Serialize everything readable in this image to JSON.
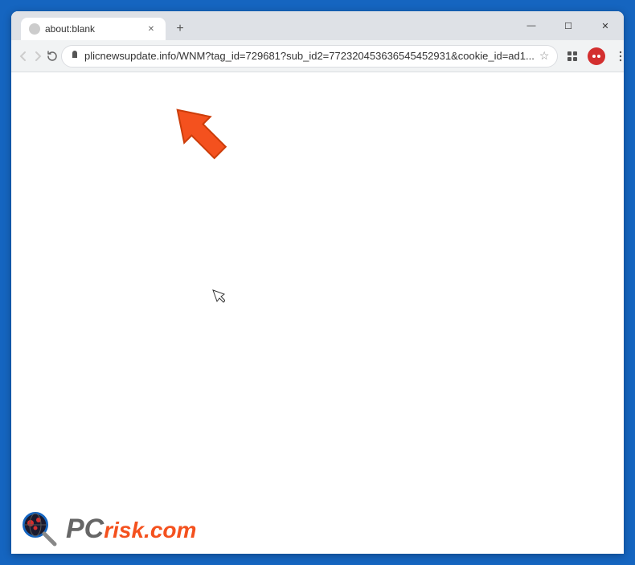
{
  "browser": {
    "tab": {
      "title": "about:blank",
      "favicon": "·"
    },
    "new_tab_label": "+",
    "window_controls": {
      "minimize": "—",
      "maximize": "☐",
      "close": "✕"
    },
    "toolbar": {
      "back_label": "‹",
      "forward_label": "›",
      "reload_label": "✕",
      "address": "plicnewsupdate.info/WNM?tag_id=729681?sub_id2=772320453636545452931&cookie_id=ad1...",
      "star_label": "☆",
      "extensions_label": "⊞",
      "profile_label": "●",
      "menu_label": "⋮"
    },
    "page": {
      "bg_color": "#ffffff"
    }
  },
  "watermark": {
    "pc_text": "PC",
    "risk_text": "risk.com"
  },
  "colors": {
    "border": "#1565C0",
    "tab_bg": "#DEE1E6",
    "toolbar_bg": "#F1F3F4",
    "arrow_fill": "#F4511E",
    "profile_bg": "#d32f2f"
  }
}
